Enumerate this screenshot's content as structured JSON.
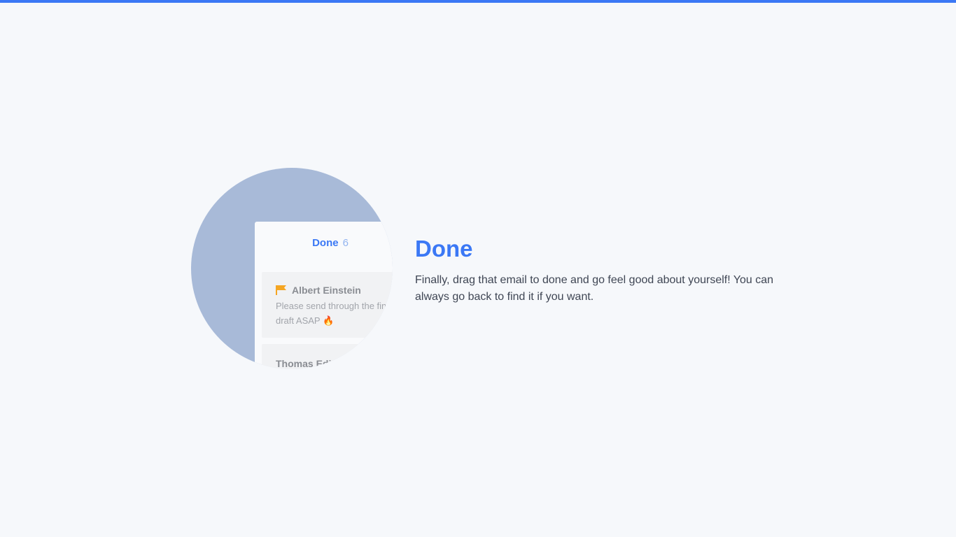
{
  "colors": {
    "accent": "#3b78f5",
    "background": "#f6f8fb",
    "circle": "#a8bad8",
    "flag": "#f5a623"
  },
  "illustration": {
    "column_title": "Done",
    "column_count": "6",
    "cards": [
      {
        "sender": "Albert Einstein",
        "icon": "flag-icon",
        "preview": "Please send through the final draft ASAP",
        "preview_icon": "🔥"
      },
      {
        "sender": "Thomas Edi"
      }
    ]
  },
  "content": {
    "heading": "Done",
    "body": "Finally, drag that email to done and go feel good about yourself! You can always go back to find it if you want."
  }
}
